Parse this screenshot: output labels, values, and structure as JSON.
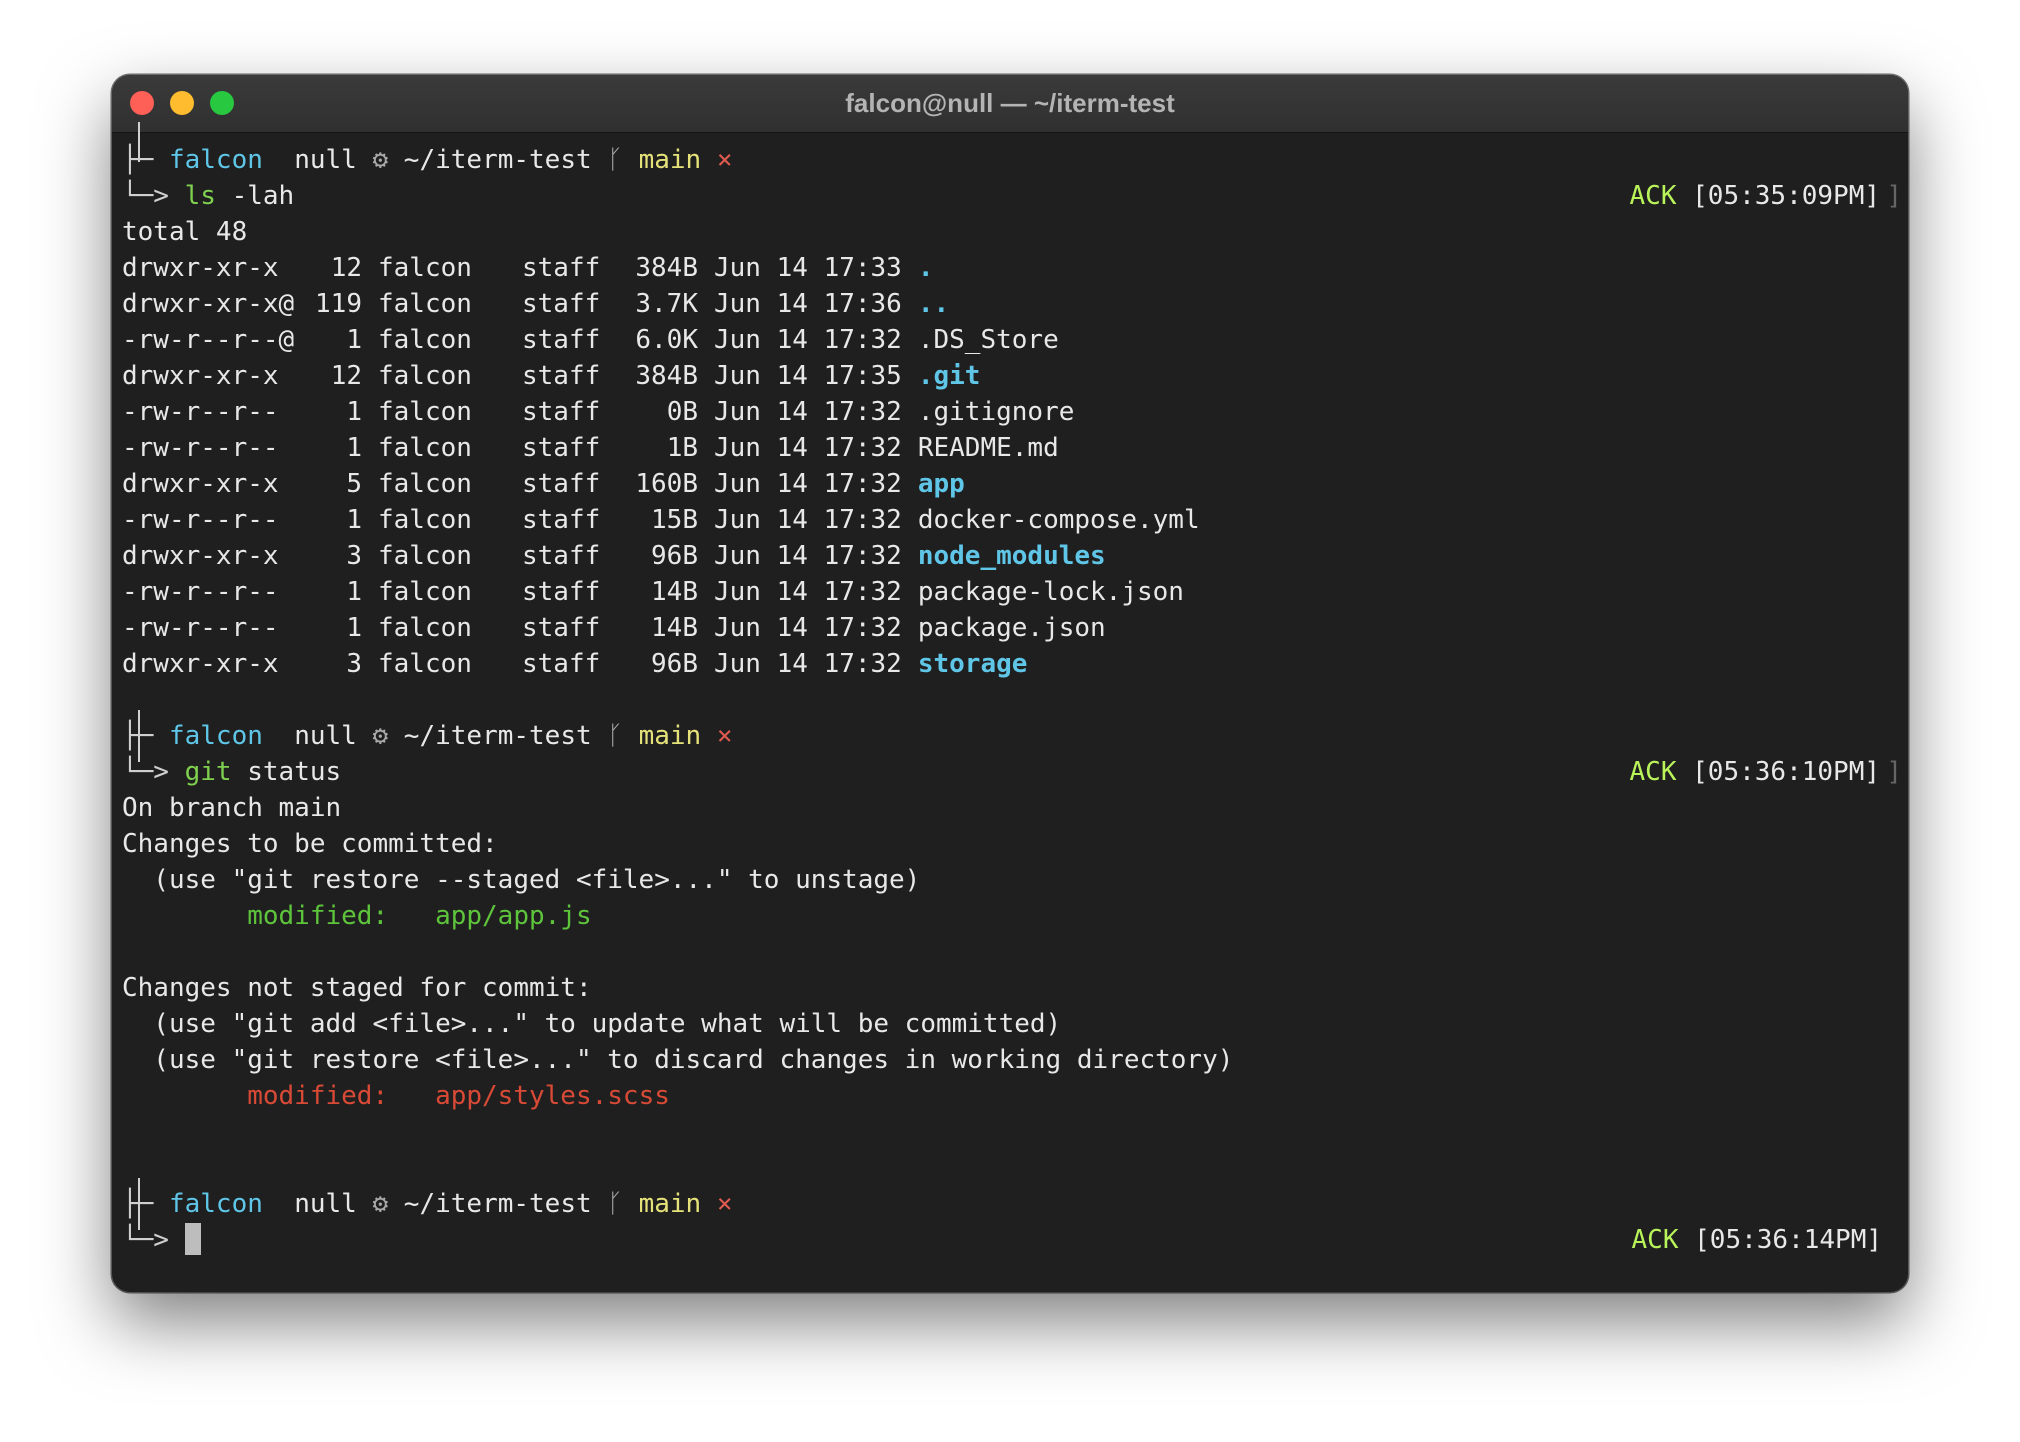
{
  "window": {
    "title": "falcon@null — ~/iterm-test"
  },
  "prompt": {
    "user": "falcon",
    "apple_icon": "apple-icon",
    "host": "null",
    "gear_icon": "gear-icon",
    "path": "~/iterm-test",
    "branch_icon": "git-branch-icon",
    "branch": "main",
    "dirty": "×",
    "arrow": "└─>",
    "tee": "├─"
  },
  "blocks": [
    {
      "command_name": "ls",
      "command_args": " -lah",
      "ack_label": "ACK",
      "time": "[05:35:09PM]"
    },
    {
      "command_name": "git",
      "command_args": " status",
      "ack_label": "ACK",
      "time": "[05:36:10PM]"
    },
    {
      "ack_label": "ACK",
      "time": "[05:36:14PM]"
    }
  ],
  "ls_output": {
    "total": "total 48",
    "rows": [
      {
        "perms": "drwxr-xr-x",
        "links": "12",
        "owner": "falcon",
        "group": "staff",
        "size": "384B",
        "date": "Jun 14 17:33",
        "name": ".",
        "is_dir": true
      },
      {
        "perms": "drwxr-xr-x@",
        "links": "119",
        "owner": "falcon",
        "group": "staff",
        "size": "3.7K",
        "date": "Jun 14 17:36",
        "name": "..",
        "is_dir": true
      },
      {
        "perms": "-rw-r--r--@",
        "links": "1",
        "owner": "falcon",
        "group": "staff",
        "size": "6.0K",
        "date": "Jun 14 17:32",
        "name": ".DS_Store",
        "is_dir": false
      },
      {
        "perms": "drwxr-xr-x",
        "links": "12",
        "owner": "falcon",
        "group": "staff",
        "size": "384B",
        "date": "Jun 14 17:35",
        "name": ".git",
        "is_dir": true
      },
      {
        "perms": "-rw-r--r--",
        "links": "1",
        "owner": "falcon",
        "group": "staff",
        "size": "0B",
        "date": "Jun 14 17:32",
        "name": ".gitignore",
        "is_dir": false
      },
      {
        "perms": "-rw-r--r--",
        "links": "1",
        "owner": "falcon",
        "group": "staff",
        "size": "1B",
        "date": "Jun 14 17:32",
        "name": "README.md",
        "is_dir": false
      },
      {
        "perms": "drwxr-xr-x",
        "links": "5",
        "owner": "falcon",
        "group": "staff",
        "size": "160B",
        "date": "Jun 14 17:32",
        "name": "app",
        "is_dir": true
      },
      {
        "perms": "-rw-r--r--",
        "links": "1",
        "owner": "falcon",
        "group": "staff",
        "size": "15B",
        "date": "Jun 14 17:32",
        "name": "docker-compose.yml",
        "is_dir": false
      },
      {
        "perms": "drwxr-xr-x",
        "links": "3",
        "owner": "falcon",
        "group": "staff",
        "size": "96B",
        "date": "Jun 14 17:32",
        "name": "node_modules",
        "is_dir": true
      },
      {
        "perms": "-rw-r--r--",
        "links": "1",
        "owner": "falcon",
        "group": "staff",
        "size": "14B",
        "date": "Jun 14 17:32",
        "name": "package-lock.json",
        "is_dir": false
      },
      {
        "perms": "-rw-r--r--",
        "links": "1",
        "owner": "falcon",
        "group": "staff",
        "size": "14B",
        "date": "Jun 14 17:32",
        "name": "package.json",
        "is_dir": false
      },
      {
        "perms": "drwxr-xr-x",
        "links": "3",
        "owner": "falcon",
        "group": "staff",
        "size": "96B",
        "date": "Jun 14 17:32",
        "name": "storage",
        "is_dir": true
      }
    ]
  },
  "git_output": {
    "branch_line": "On branch main",
    "staged_header": "Changes to be committed:",
    "staged_hint": "  (use \"git restore --staged <file>...\" to unstage)",
    "staged_label": "        modified:",
    "staged_file": "   app/app.js",
    "unstaged_header": "Changes not staged for commit:",
    "unstaged_hint1": "  (use \"git add <file>...\" to update what will be committed)",
    "unstaged_hint2": "  (use \"git restore <file>...\" to discard changes in working directory)",
    "unstaged_label": "        modified:",
    "unstaged_file": "   app/styles.scss"
  },
  "colors": {
    "background": "#1f1f1f",
    "user": "#5fc6e8",
    "branch": "#e6e27a",
    "command": "#7fd04f",
    "ack": "#b9f35a",
    "staged": "#5ec43c",
    "unstaged": "#d84a36",
    "directory": "#5fc6e8"
  }
}
